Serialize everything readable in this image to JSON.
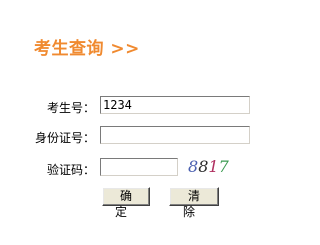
{
  "page": {
    "title": "考生查询 >>"
  },
  "form": {
    "exam_number": {
      "label": "考生号：",
      "value": "1234"
    },
    "id_number": {
      "label": "身份证号：",
      "value": ""
    },
    "captcha": {
      "label": "验证码：",
      "value": "",
      "image_text": [
        "8",
        "8",
        "1",
        "7"
      ],
      "image_colors": [
        "#4a5fb0",
        "#2a2a2a",
        "#b03060",
        "#3a9a50"
      ]
    }
  },
  "buttons": {
    "confirm_label": "确定",
    "clear_label": "清除"
  }
}
